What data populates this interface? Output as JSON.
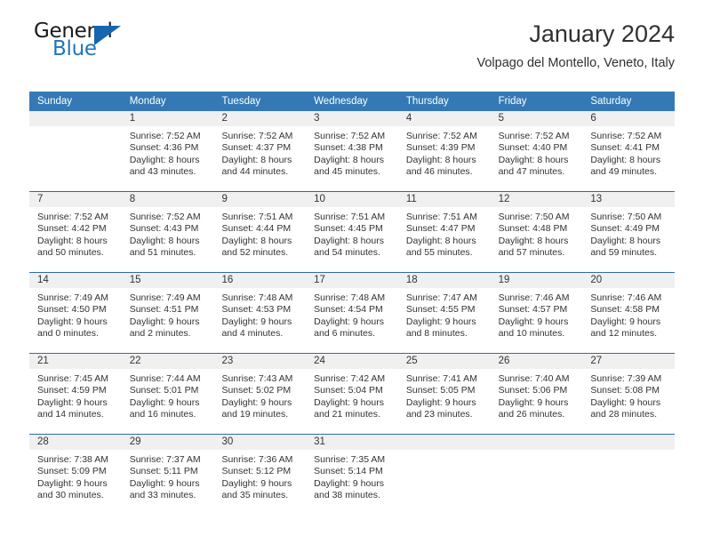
{
  "brand": {
    "name_part1": "General",
    "name_part2": "Blue",
    "logo_icon": "triangle-logo-icon"
  },
  "header": {
    "title": "January 2024",
    "subtitle": "Volpago del Montello, Veneto, Italy"
  },
  "colors": {
    "header_blue": "#3479b5",
    "row_divider_blue": "#2d6ca8",
    "day_band_gray": "#f0f0f0",
    "brand_blue": "#1f76bc"
  },
  "weekdays": [
    "Sunday",
    "Monday",
    "Tuesday",
    "Wednesday",
    "Thursday",
    "Friday",
    "Saturday"
  ],
  "weeks": [
    [
      {
        "day": "",
        "sunrise": "",
        "sunset": "",
        "daylight_line1": "",
        "daylight_line2": ""
      },
      {
        "day": "1",
        "sunrise": "Sunrise: 7:52 AM",
        "sunset": "Sunset: 4:36 PM",
        "daylight_line1": "Daylight: 8 hours",
        "daylight_line2": "and 43 minutes."
      },
      {
        "day": "2",
        "sunrise": "Sunrise: 7:52 AM",
        "sunset": "Sunset: 4:37 PM",
        "daylight_line1": "Daylight: 8 hours",
        "daylight_line2": "and 44 minutes."
      },
      {
        "day": "3",
        "sunrise": "Sunrise: 7:52 AM",
        "sunset": "Sunset: 4:38 PM",
        "daylight_line1": "Daylight: 8 hours",
        "daylight_line2": "and 45 minutes."
      },
      {
        "day": "4",
        "sunrise": "Sunrise: 7:52 AM",
        "sunset": "Sunset: 4:39 PM",
        "daylight_line1": "Daylight: 8 hours",
        "daylight_line2": "and 46 minutes."
      },
      {
        "day": "5",
        "sunrise": "Sunrise: 7:52 AM",
        "sunset": "Sunset: 4:40 PM",
        "daylight_line1": "Daylight: 8 hours",
        "daylight_line2": "and 47 minutes."
      },
      {
        "day": "6",
        "sunrise": "Sunrise: 7:52 AM",
        "sunset": "Sunset: 4:41 PM",
        "daylight_line1": "Daylight: 8 hours",
        "daylight_line2": "and 49 minutes."
      }
    ],
    [
      {
        "day": "7",
        "sunrise": "Sunrise: 7:52 AM",
        "sunset": "Sunset: 4:42 PM",
        "daylight_line1": "Daylight: 8 hours",
        "daylight_line2": "and 50 minutes."
      },
      {
        "day": "8",
        "sunrise": "Sunrise: 7:52 AM",
        "sunset": "Sunset: 4:43 PM",
        "daylight_line1": "Daylight: 8 hours",
        "daylight_line2": "and 51 minutes."
      },
      {
        "day": "9",
        "sunrise": "Sunrise: 7:51 AM",
        "sunset": "Sunset: 4:44 PM",
        "daylight_line1": "Daylight: 8 hours",
        "daylight_line2": "and 52 minutes."
      },
      {
        "day": "10",
        "sunrise": "Sunrise: 7:51 AM",
        "sunset": "Sunset: 4:45 PM",
        "daylight_line1": "Daylight: 8 hours",
        "daylight_line2": "and 54 minutes."
      },
      {
        "day": "11",
        "sunrise": "Sunrise: 7:51 AM",
        "sunset": "Sunset: 4:47 PM",
        "daylight_line1": "Daylight: 8 hours",
        "daylight_line2": "and 55 minutes."
      },
      {
        "day": "12",
        "sunrise": "Sunrise: 7:50 AM",
        "sunset": "Sunset: 4:48 PM",
        "daylight_line1": "Daylight: 8 hours",
        "daylight_line2": "and 57 minutes."
      },
      {
        "day": "13",
        "sunrise": "Sunrise: 7:50 AM",
        "sunset": "Sunset: 4:49 PM",
        "daylight_line1": "Daylight: 8 hours",
        "daylight_line2": "and 59 minutes."
      }
    ],
    [
      {
        "day": "14",
        "sunrise": "Sunrise: 7:49 AM",
        "sunset": "Sunset: 4:50 PM",
        "daylight_line1": "Daylight: 9 hours",
        "daylight_line2": "and 0 minutes."
      },
      {
        "day": "15",
        "sunrise": "Sunrise: 7:49 AM",
        "sunset": "Sunset: 4:51 PM",
        "daylight_line1": "Daylight: 9 hours",
        "daylight_line2": "and 2 minutes."
      },
      {
        "day": "16",
        "sunrise": "Sunrise: 7:48 AM",
        "sunset": "Sunset: 4:53 PM",
        "daylight_line1": "Daylight: 9 hours",
        "daylight_line2": "and 4 minutes."
      },
      {
        "day": "17",
        "sunrise": "Sunrise: 7:48 AM",
        "sunset": "Sunset: 4:54 PM",
        "daylight_line1": "Daylight: 9 hours",
        "daylight_line2": "and 6 minutes."
      },
      {
        "day": "18",
        "sunrise": "Sunrise: 7:47 AM",
        "sunset": "Sunset: 4:55 PM",
        "daylight_line1": "Daylight: 9 hours",
        "daylight_line2": "and 8 minutes."
      },
      {
        "day": "19",
        "sunrise": "Sunrise: 7:46 AM",
        "sunset": "Sunset: 4:57 PM",
        "daylight_line1": "Daylight: 9 hours",
        "daylight_line2": "and 10 minutes."
      },
      {
        "day": "20",
        "sunrise": "Sunrise: 7:46 AM",
        "sunset": "Sunset: 4:58 PM",
        "daylight_line1": "Daylight: 9 hours",
        "daylight_line2": "and 12 minutes."
      }
    ],
    [
      {
        "day": "21",
        "sunrise": "Sunrise: 7:45 AM",
        "sunset": "Sunset: 4:59 PM",
        "daylight_line1": "Daylight: 9 hours",
        "daylight_line2": "and 14 minutes."
      },
      {
        "day": "22",
        "sunrise": "Sunrise: 7:44 AM",
        "sunset": "Sunset: 5:01 PM",
        "daylight_line1": "Daylight: 9 hours",
        "daylight_line2": "and 16 minutes."
      },
      {
        "day": "23",
        "sunrise": "Sunrise: 7:43 AM",
        "sunset": "Sunset: 5:02 PM",
        "daylight_line1": "Daylight: 9 hours",
        "daylight_line2": "and 19 minutes."
      },
      {
        "day": "24",
        "sunrise": "Sunrise: 7:42 AM",
        "sunset": "Sunset: 5:04 PM",
        "daylight_line1": "Daylight: 9 hours",
        "daylight_line2": "and 21 minutes."
      },
      {
        "day": "25",
        "sunrise": "Sunrise: 7:41 AM",
        "sunset": "Sunset: 5:05 PM",
        "daylight_line1": "Daylight: 9 hours",
        "daylight_line2": "and 23 minutes."
      },
      {
        "day": "26",
        "sunrise": "Sunrise: 7:40 AM",
        "sunset": "Sunset: 5:06 PM",
        "daylight_line1": "Daylight: 9 hours",
        "daylight_line2": "and 26 minutes."
      },
      {
        "day": "27",
        "sunrise": "Sunrise: 7:39 AM",
        "sunset": "Sunset: 5:08 PM",
        "daylight_line1": "Daylight: 9 hours",
        "daylight_line2": "and 28 minutes."
      }
    ],
    [
      {
        "day": "28",
        "sunrise": "Sunrise: 7:38 AM",
        "sunset": "Sunset: 5:09 PM",
        "daylight_line1": "Daylight: 9 hours",
        "daylight_line2": "and 30 minutes."
      },
      {
        "day": "29",
        "sunrise": "Sunrise: 7:37 AM",
        "sunset": "Sunset: 5:11 PM",
        "daylight_line1": "Daylight: 9 hours",
        "daylight_line2": "and 33 minutes."
      },
      {
        "day": "30",
        "sunrise": "Sunrise: 7:36 AM",
        "sunset": "Sunset: 5:12 PM",
        "daylight_line1": "Daylight: 9 hours",
        "daylight_line2": "and 35 minutes."
      },
      {
        "day": "31",
        "sunrise": "Sunrise: 7:35 AM",
        "sunset": "Sunset: 5:14 PM",
        "daylight_line1": "Daylight: 9 hours",
        "daylight_line2": "and 38 minutes."
      },
      {
        "day": "",
        "sunrise": "",
        "sunset": "",
        "daylight_line1": "",
        "daylight_line2": ""
      },
      {
        "day": "",
        "sunrise": "",
        "sunset": "",
        "daylight_line1": "",
        "daylight_line2": ""
      },
      {
        "day": "",
        "sunrise": "",
        "sunset": "",
        "daylight_line1": "",
        "daylight_line2": ""
      }
    ]
  ]
}
